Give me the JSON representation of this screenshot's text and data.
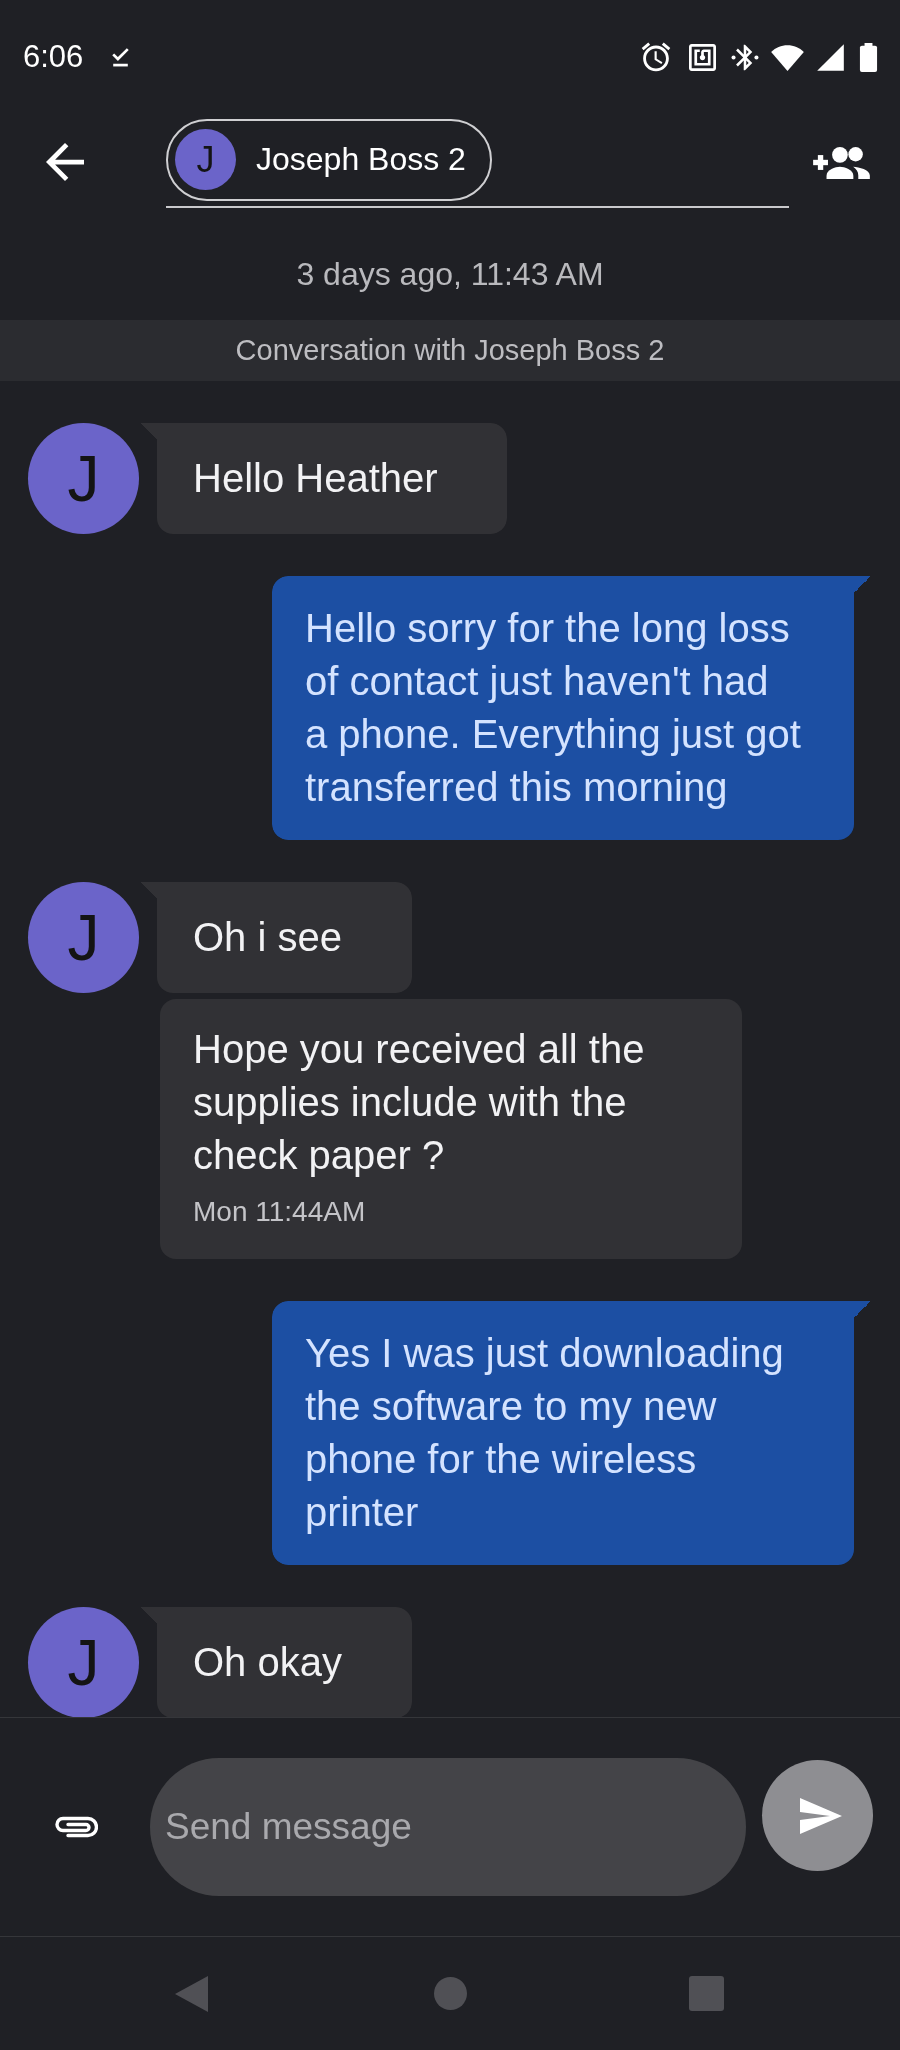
{
  "status_bar": {
    "time": "6:06"
  },
  "header": {
    "contact": {
      "initial": "J",
      "name": "Joseph Boss 2"
    }
  },
  "conversation": {
    "started": "3 days ago, 11:43 AM",
    "banner": "Conversation with Joseph Boss 2"
  },
  "messages": [
    {
      "kind": "received",
      "avatar": "J",
      "text": "Hello Heather"
    },
    {
      "kind": "sent",
      "text": "Hello sorry for the long loss of contact just haven't had a phone. Everything just got transferred this morning"
    },
    {
      "kind": "received",
      "avatar": "J",
      "text": "Oh i see"
    },
    {
      "kind": "received",
      "text": "Hope you received all the supplies include with the check paper ?",
      "time": "Mon 11:44AM"
    },
    {
      "kind": "sent",
      "text": "Yes I was just downloading the software to my new phone for the wireless printer"
    },
    {
      "kind": "received",
      "avatar": "J",
      "text": "Oh okay"
    }
  ],
  "composer": {
    "placeholder": "Send message"
  }
}
